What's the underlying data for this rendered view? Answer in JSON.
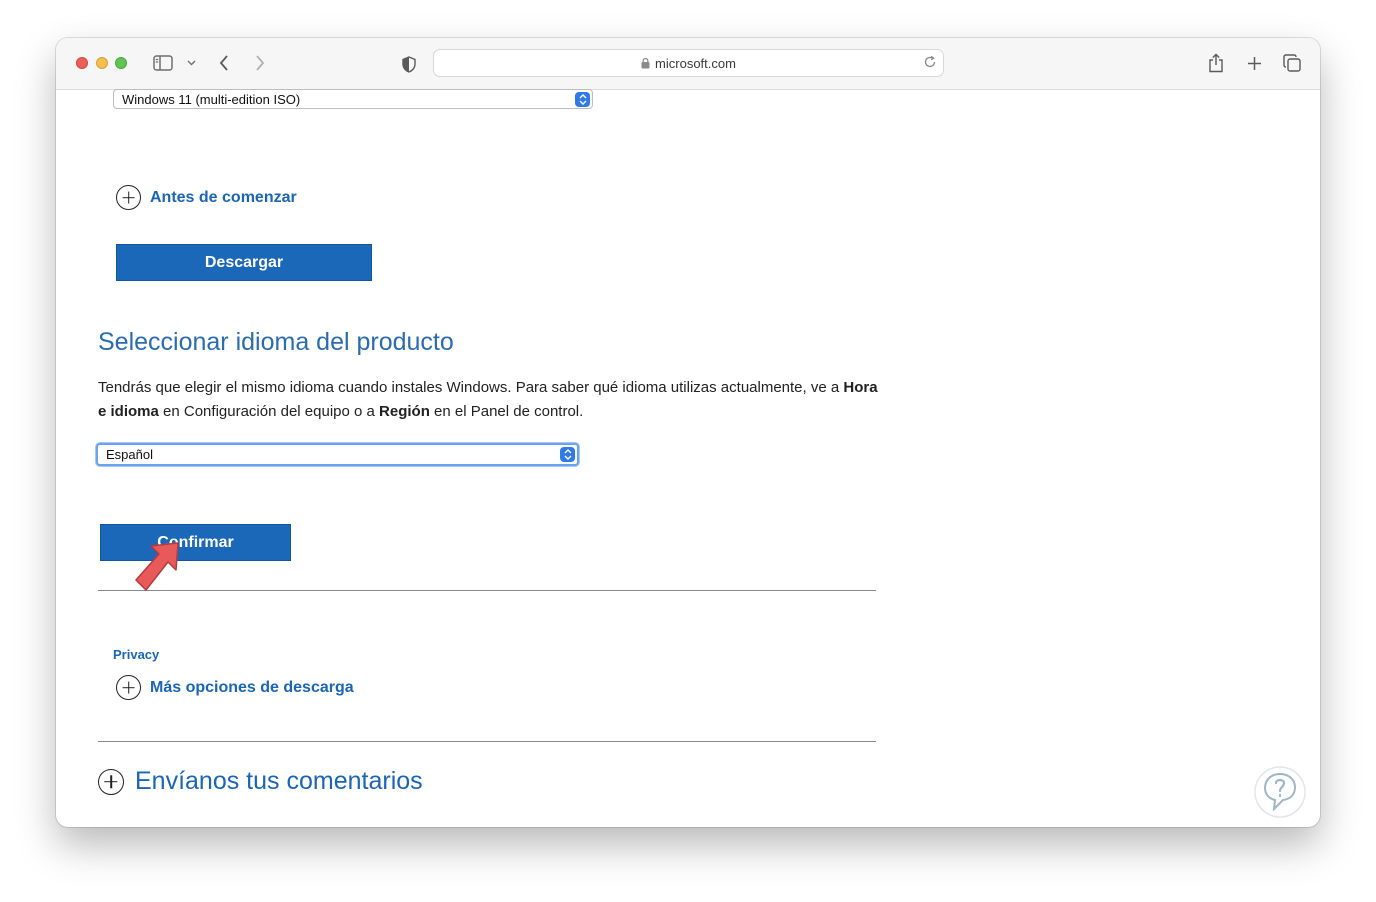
{
  "browser": {
    "url": "microsoft.com"
  },
  "page": {
    "edition_select_value": "Windows 11 (multi-edition ISO)",
    "before_start_label": "Antes de comenzar",
    "download_button": "Descargar",
    "language_heading": "Seleccionar idioma del producto",
    "language_para_1": "Tendrás que elegir el mismo idioma cuando instales Windows. Para saber qué idioma utilizas actualmente, ve a ",
    "language_para_bold_1": "Hora e idioma",
    "language_para_2": " en Configuración del equipo o a ",
    "language_para_bold_2": "Región",
    "language_para_3": " en el Panel de control.",
    "language_select_value": "Español",
    "confirm_button": "Confirmar",
    "privacy_link": "Privacy",
    "more_options_label": "Más opciones de descarga",
    "feedback_label": "Envíanos tus comentarios"
  },
  "colors": {
    "link_blue": "#1b65b7",
    "button_blue": "#1b67b8",
    "heading_blue": "#2b6cb0",
    "annotation_arrow": "#e8595a"
  },
  "icons": [
    "sidebar-icon",
    "chevron-down-icon",
    "back-icon",
    "forward-icon",
    "shield-icon",
    "lock-icon",
    "reload-icon",
    "share-icon",
    "new-tab-icon",
    "tabs-overview-icon",
    "plus-circle-icon",
    "annotation-arrow-icon",
    "watermark-logo-icon"
  ]
}
